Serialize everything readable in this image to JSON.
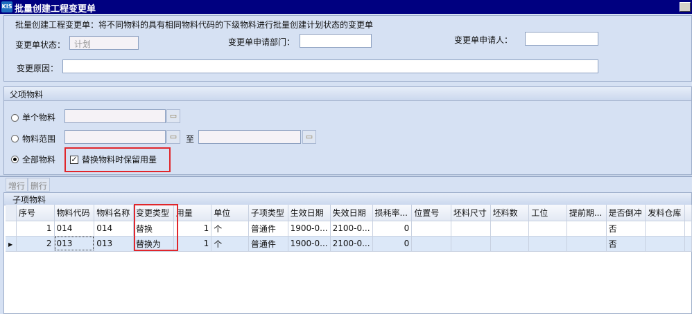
{
  "window": {
    "title": "批量创建工程变更单",
    "logo": "KIS"
  },
  "header": {
    "description": "批量创建工程变更单：将不同物料的具有相同物料代码的下级物料进行批量创建计划状态的变更单",
    "status_label": "变更单状态：",
    "status_value": "计划",
    "dept_label": "变更单申请部门：",
    "dept_value": "",
    "applicant_label": "变更单申请人：",
    "applicant_value": "",
    "reason_label": "变更原因：",
    "reason_value": ""
  },
  "parent": {
    "title": "父项物料",
    "single_label": "单个物料",
    "range_label": "物料范围",
    "to_label": "至",
    "all_label": "全部物料",
    "keep_qty_label": "替换物料时保留用量",
    "selected": "all",
    "keep_qty_checked": true
  },
  "toolbar": {
    "add_row": "增行",
    "del_row": "删行"
  },
  "child": {
    "title": "子项物料",
    "columns": [
      "序号",
      "物料代码",
      "物料名称",
      "变更类型",
      "用量",
      "单位",
      "子项类型",
      "生效日期",
      "失效日期",
      "损耗率...",
      "位置号",
      "坯料尺寸",
      "坯料数",
      "工位",
      "提前期...",
      "是否倒冲",
      "发料仓库",
      ""
    ],
    "rows": [
      [
        "1",
        "014",
        "014",
        "替换",
        "1",
        "个",
        "普通件",
        "1900-0...",
        "2100-0...",
        "0",
        "",
        "",
        "",
        "",
        "",
        "否",
        "",
        ""
      ],
      [
        "2",
        "013",
        "013",
        "替换为",
        "1",
        "个",
        "普通件",
        "1900-0...",
        "2100-0...",
        "0",
        "",
        "",
        "",
        "",
        "",
        "否",
        "",
        ""
      ]
    ]
  },
  "colors": {
    "titlebar": "#000080",
    "highlight": "#e0262b",
    "background": "#d6e1f3"
  }
}
